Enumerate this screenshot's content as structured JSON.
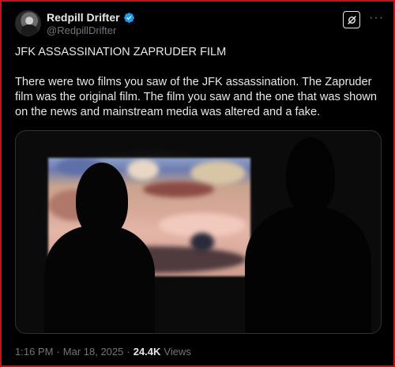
{
  "author": {
    "display_name": "Redpill Drifter",
    "handle": "@RedpillDrifter",
    "verified": true,
    "avatar_icon": "avatar-image"
  },
  "header_actions": {
    "grok_icon": "grok-icon",
    "more_icon": "more-icon",
    "more_label": "···"
  },
  "tweet": {
    "paragraphs": [
      "JFK ASSASSINATION ZAPRUDER FILM",
      "There were two films you saw of the JFK assassination. The Zapruder film was the original film. The film you saw and the one that was shown on the news and mainstream media was altered and a fake."
    ]
  },
  "media": {
    "type": "video-still"
  },
  "meta": {
    "time": "1:16 PM",
    "separator": "·",
    "date": "Mar 18, 2025",
    "views_count": "24.4K",
    "views_label": "Views"
  },
  "colors": {
    "background": "#000000",
    "frame_border": "#c4141b",
    "text_primary": "#e7e9ea",
    "text_secondary": "#71767b",
    "verified_blue": "#1d9bf0"
  }
}
